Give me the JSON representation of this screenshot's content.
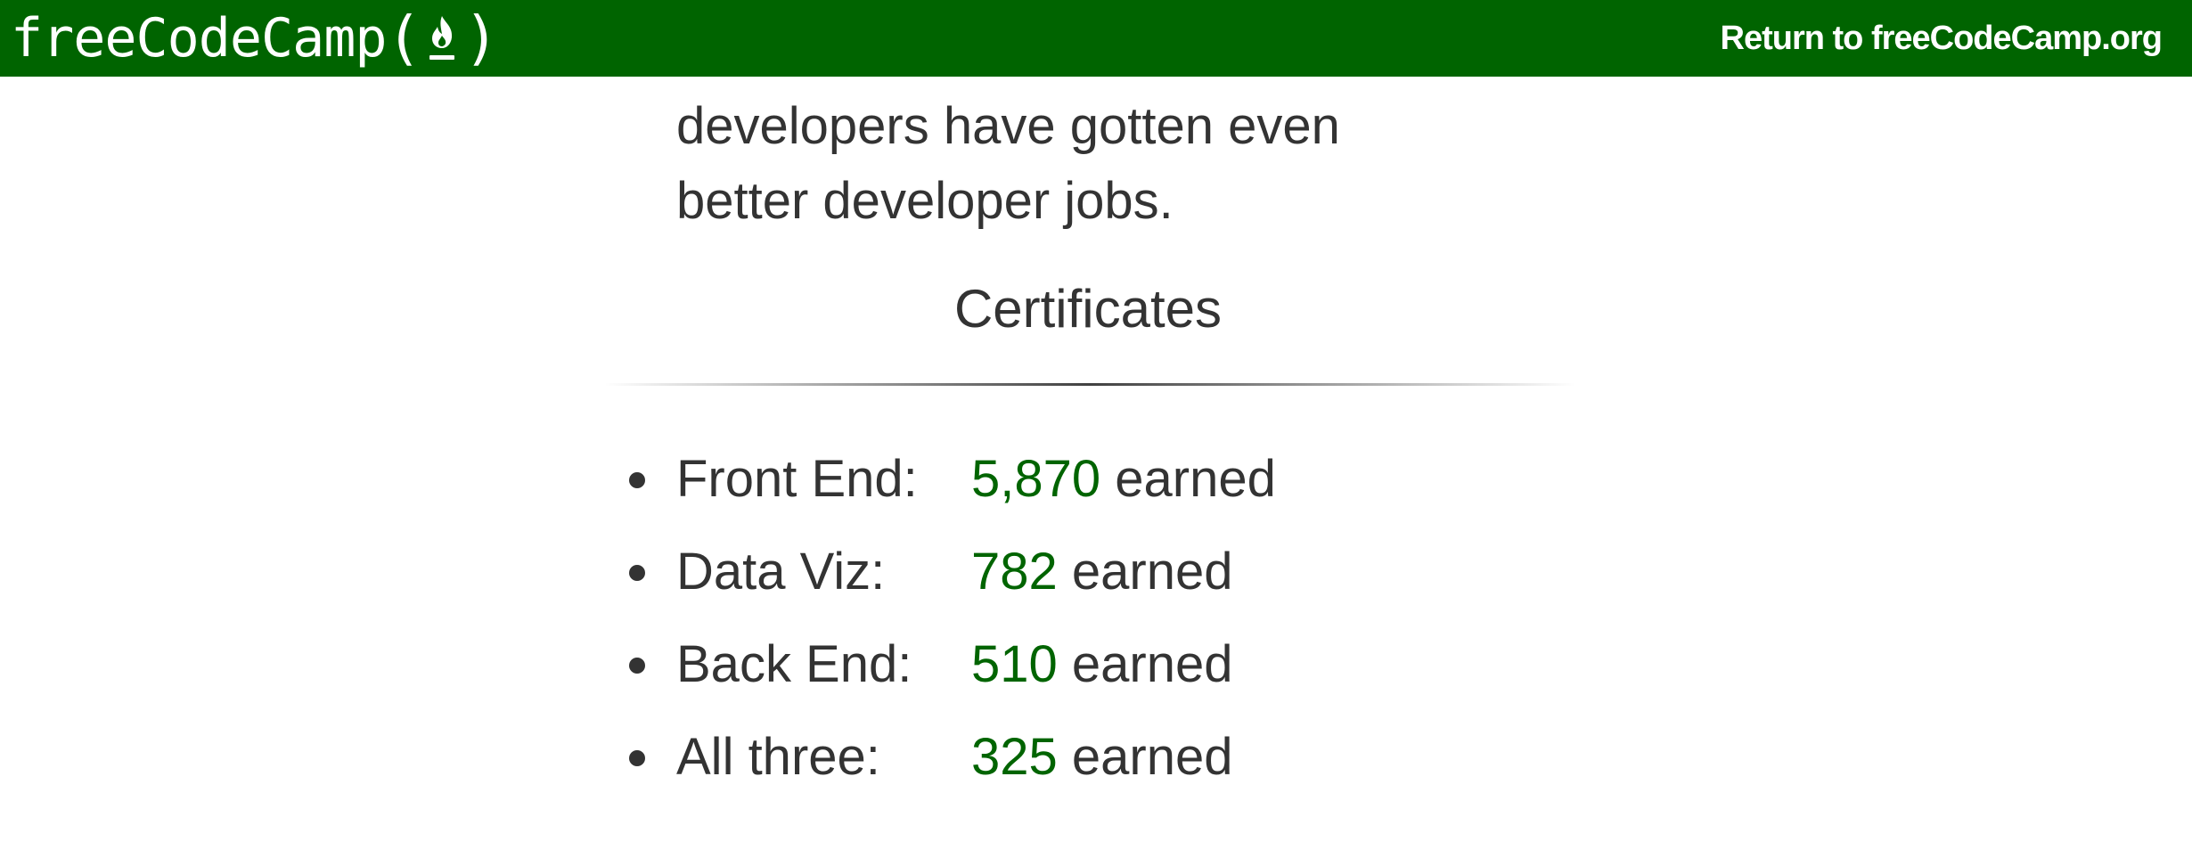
{
  "navbar": {
    "brand_text": "freeCodeCamp",
    "brand_open": "(",
    "brand_close": ")",
    "return_link": "Return to freeCodeCamp.org",
    "background": "#006400"
  },
  "intro": {
    "lines": [
      "developers have gotten even",
      "better developer jobs."
    ]
  },
  "certificates": {
    "heading": "Certificates",
    "accent_color": "#006400",
    "items": [
      {
        "label": "Front End:",
        "count": "5,870",
        "suffix": "earned"
      },
      {
        "label": "Data Viz:",
        "count": "782",
        "suffix": "earned"
      },
      {
        "label": "Back End:",
        "count": "510",
        "suffix": "earned"
      },
      {
        "label": "All three:",
        "count": "325",
        "suffix": "earned"
      }
    ]
  },
  "icons": {
    "brand_flame": "fire-icon"
  }
}
